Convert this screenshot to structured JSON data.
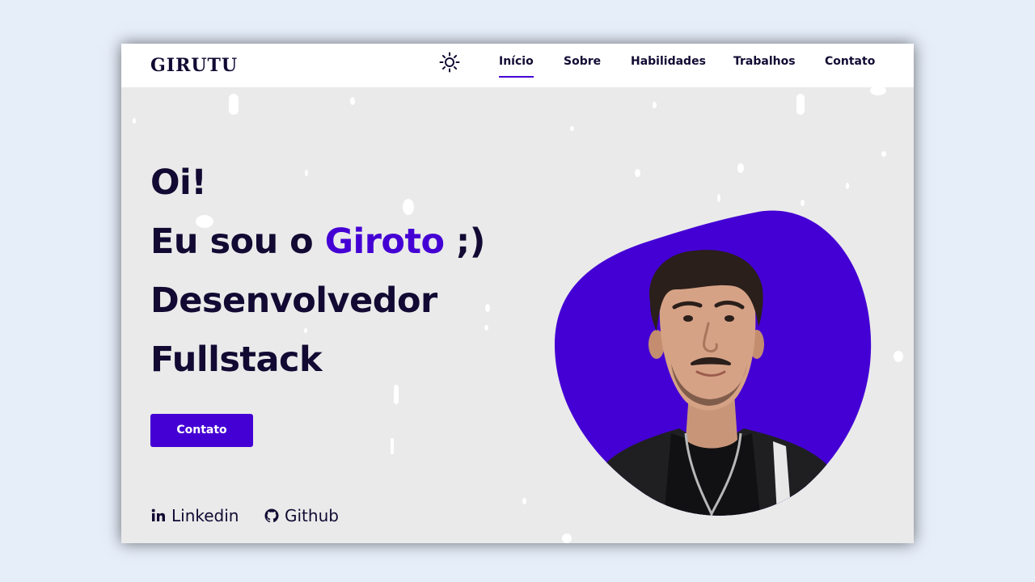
{
  "colors": {
    "accent": "#4400d4",
    "text": "#120a33",
    "background": "#eaeaea",
    "navbar": "#ffffff"
  },
  "logo": {
    "text": "GIRUTU"
  },
  "theme_toggle": {
    "icon": "sun-icon"
  },
  "nav": {
    "items": [
      {
        "label": "Início",
        "active": true
      },
      {
        "label": "Sobre",
        "active": false
      },
      {
        "label": "Habilidades",
        "active": false
      },
      {
        "label": "Trabalhos",
        "active": false
      },
      {
        "label": "Contato",
        "active": false
      }
    ]
  },
  "hero": {
    "greeting": "Oi!",
    "intro_prefix": "Eu sou o ",
    "name": "Giroto",
    "intro_suffix": " ;)",
    "role_line1": "Desenvolvedor",
    "role_line2": "Fullstack",
    "cta_label": "Contato",
    "portrait_icon": "profile-photo"
  },
  "social": {
    "linkedin": {
      "label": "Linkedin",
      "icon": "linkedin-icon"
    },
    "github": {
      "label": "Github",
      "icon": "github-icon"
    }
  }
}
